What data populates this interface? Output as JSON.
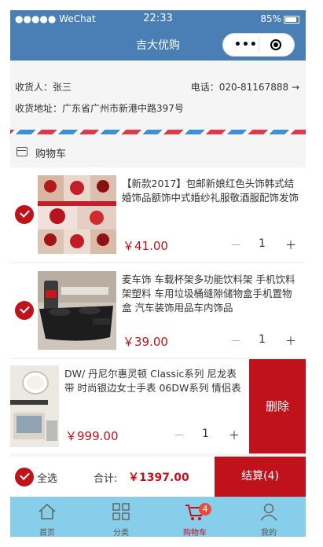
{
  "status_bar": {
    "carrier": "●●●●● WeChat",
    "time": "22:33",
    "battery": "85%"
  },
  "nav": {
    "title": "吉大优购"
  },
  "address": {
    "receiver": "收货人：张三",
    "phone": "电话：020-81167888",
    "address": "收货地址：广东省广州市新港中路397号"
  },
  "cart": {
    "title": "购物车"
  },
  "items": [
    {
      "name": "【新款2017】包邮新娘红色头饰韩式结婚饰品额饰中式婚纱礼服敬酒服配饰发饰",
      "price": "￥41.00",
      "qty": "1",
      "minus": "－",
      "plus": "＋"
    },
    {
      "name": "麦车饰 车载杯架多功能饮料架 手机饮料架塑料 车用垃圾桶缝隙储物盒手机置物盒 汽车装饰用品车内饰品",
      "price": "￥39.00",
      "qty": "1",
      "minus": "－",
      "plus": "＋"
    },
    {
      "name": "DW/ 丹尼尔惠灵顿 Classic系列 尼龙表带 时尚银边女士手表 06DW系列 情侣表",
      "price": "￥999.00",
      "qty": "1",
      "minus": "－",
      "plus": "＋",
      "delete_label": "删除"
    }
  ],
  "footer": {
    "select_all": "全选",
    "total_label": "合计:",
    "total": "￥1397.00",
    "checkout": "结算(4)"
  },
  "tabs": [
    {
      "label": "首页",
      "icon": "home-icon"
    },
    {
      "label": "分类",
      "icon": "category-icon"
    },
    {
      "label": "购物车",
      "icon": "cart-icon",
      "badge": "4",
      "active": true
    },
    {
      "label": "我的",
      "icon": "user-icon"
    }
  ],
  "colors": {
    "accent": "#c0121a",
    "nav": "#4a7fb5",
    "tabbar": "#87ceeb"
  }
}
